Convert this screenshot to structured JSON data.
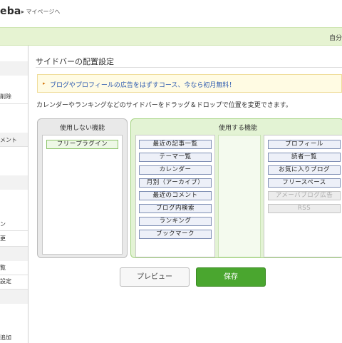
{
  "header": {
    "logo": "eba",
    "mypage_link": "▸ マイページへ",
    "right_text": "自分"
  },
  "sidebar": {
    "items": [
      "削除",
      "メント",
      "ン",
      "更",
      "覧",
      "設定",
      "追加"
    ]
  },
  "main": {
    "title": "サイドバーの配置設定",
    "notice": "ブログやプロフィールの広告をはずすコース、今なら初月無料！",
    "notice_arrow": "▸",
    "description": "カレンダーやランキングなどのサイドバーをドラッグ＆ドロップで位置を変更できます。"
  },
  "unused": {
    "heading": "使用しない機能",
    "items": [
      "フリープラグイン"
    ]
  },
  "used": {
    "heading": "使用する機能",
    "column_a": [
      "最近の記事一覧",
      "テーマ一覧",
      "カレンダー",
      "月別（アーカイブ）",
      "最近のコメント",
      "ブログ内検索",
      "ランキング",
      "ブックマーク"
    ],
    "column_c": [
      "プロフィール",
      "読者一覧",
      "お気に入りブログ",
      "フリースペース"
    ],
    "column_c_disabled": [
      "アメーバブログ広告",
      "RSS"
    ]
  },
  "buttons": {
    "preview": "プレビュー",
    "save": "保存"
  },
  "colors": {
    "accent_green": "#4aa62f",
    "header_band": "#e6f3d2",
    "link_blue": "#2a58b0"
  }
}
